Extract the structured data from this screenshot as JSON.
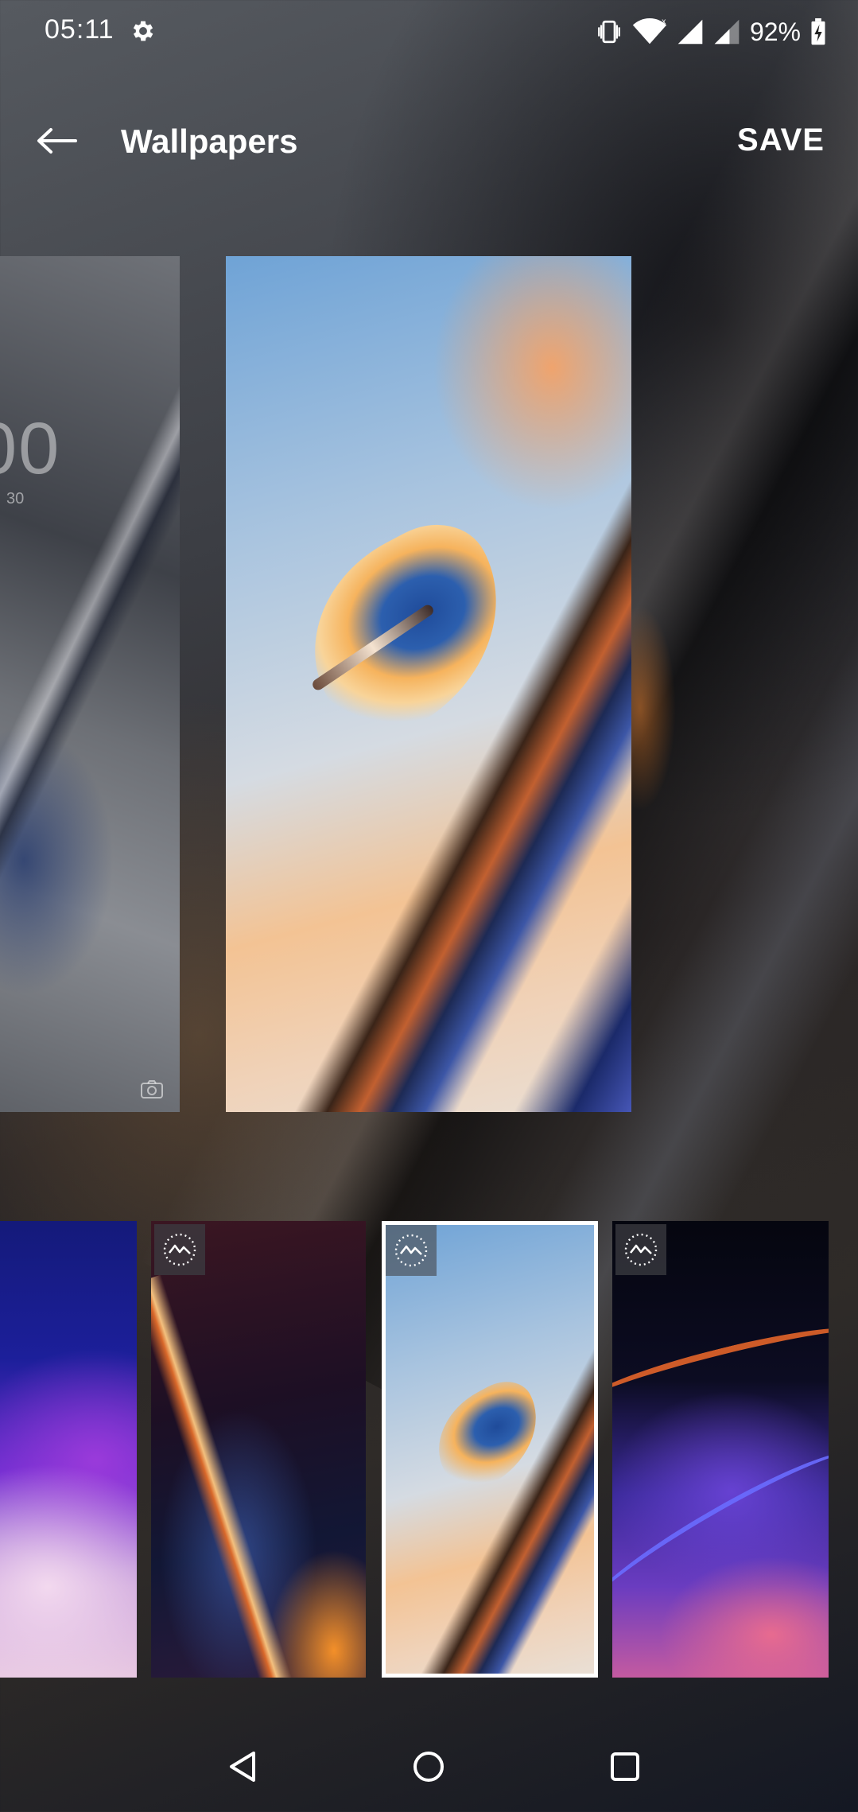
{
  "status_bar": {
    "time": "05:11",
    "battery_percent": "92%",
    "icons": [
      "settings-gear-icon",
      "vibrate-icon",
      "wifi-icon",
      "signal-icon",
      "signal-weak-icon",
      "battery-charging-icon"
    ]
  },
  "app_bar": {
    "title": "Wallpapers",
    "save_label": "SAVE",
    "back_icon": "arrow-left-icon"
  },
  "preview": {
    "lock_clock": "00",
    "lock_date": "30",
    "lock_camera_icon": "camera-icon"
  },
  "thumbnails": [
    {
      "name": "purple-wave",
      "live": false,
      "selected": false
    },
    {
      "name": "dark-red-flame",
      "live": true,
      "selected": false
    },
    {
      "name": "blue-orange-curl",
      "live": true,
      "selected": true
    },
    {
      "name": "violet-night",
      "live": true,
      "selected": false
    }
  ],
  "nav_bar": {
    "icons": [
      "back-triangle-icon",
      "home-circle-icon",
      "recents-square-icon"
    ]
  },
  "colors": {
    "accent": "#ffffff",
    "selected_border": "#ffffff"
  }
}
